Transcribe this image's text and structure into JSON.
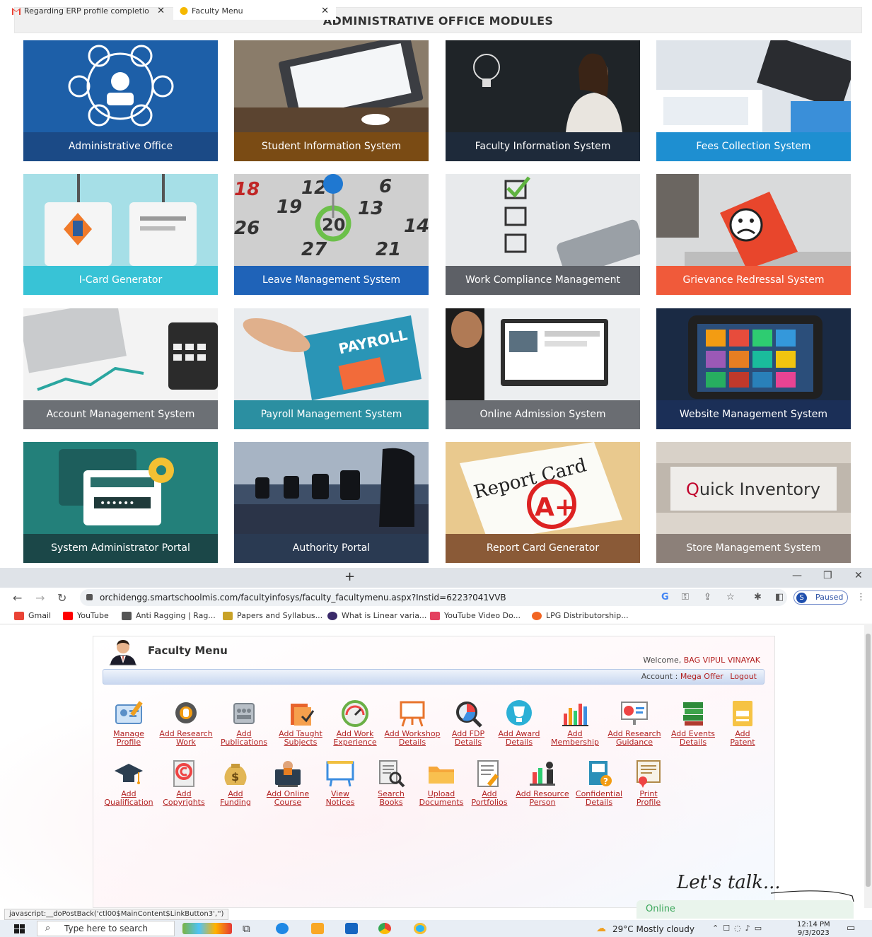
{
  "modules": {
    "heading": "ADMINISTRATIVE OFFICE MODULES",
    "tiles": [
      {
        "label": "Administrative Office",
        "color": "#1b4a86"
      },
      {
        "label": "Student Information System",
        "color": "#7a4b14"
      },
      {
        "label": "Faculty Information System",
        "color": "#1e2a3a"
      },
      {
        "label": "Fees Collection System",
        "color": "#1e8fd1"
      },
      {
        "label": "I-Card Generator",
        "color": "#38c3d6"
      },
      {
        "label": "Leave Management System",
        "color": "#1f63b8"
      },
      {
        "label": "Work Compliance Management",
        "color": "#5d6066"
      },
      {
        "label": "Grievance Redressal System",
        "color": "#f05a3a"
      },
      {
        "label": "Account Management System",
        "color": "#6c7075"
      },
      {
        "label": "Payroll Management System",
        "color": "#2b8fa1"
      },
      {
        "label": "Online Admission System",
        "color": "#6a6d72"
      },
      {
        "label": "Website Management System",
        "color": "#1b2f57"
      },
      {
        "label": "System Administrator Portal",
        "color": "#1b4748"
      },
      {
        "label": "Authority Portal",
        "color": "#2a3a52"
      },
      {
        "label": "Report Card Generator",
        "color": "#8a5a37"
      },
      {
        "label": "Store Management System",
        "color": "#8c8079"
      }
    ]
  },
  "browser": {
    "tabs": [
      {
        "title": "Regarding ERP profile completio",
        "icon": "gmail-icon"
      },
      {
        "title": "Faculty Menu",
        "icon": "site-icon"
      }
    ],
    "new_tab": "+",
    "url": "orchidengg.smartschoolmis.com/facultyinfosys/faculty_facultymenu.aspx?Instid=6223?041VVB",
    "profile_status": "Paused",
    "profile_initial": "S",
    "bookmarks": [
      {
        "label": "Gmail",
        "color": "#ea4335"
      },
      {
        "label": "YouTube",
        "color": "#ff0000"
      },
      {
        "label": "Anti Ragging | Rag...",
        "color": "#555555"
      },
      {
        "label": "Papers and Syllabus...",
        "color": "#c9a227"
      },
      {
        "label": "What is Linear varia...",
        "color": "#3a2a6a"
      },
      {
        "label": "YouTube Video Do...",
        "color": "#e4405f"
      },
      {
        "label": "LPG Distributorship...",
        "color": "#f26522"
      }
    ]
  },
  "faculty": {
    "title": "Faculty Menu",
    "welcome_prefix": "Welcome,",
    "user": "BAG VIPUL VINAYAK",
    "account_prefix": "Account :",
    "account": "Mega Offer",
    "logout": "Logout",
    "menu_items": [
      {
        "l1": "Manage",
        "l2": "Profile",
        "icon": "profile-card-icon"
      },
      {
        "l1": "Add Research",
        "l2": "Work",
        "icon": "research-gear-icon"
      },
      {
        "l1": "Add",
        "l2": "Publications",
        "icon": "publications-icon"
      },
      {
        "l1": "Add Taught",
        "l2": "Subjects",
        "icon": "subjects-icon"
      },
      {
        "l1": "Add Work",
        "l2": "Experience",
        "icon": "gauge-icon"
      },
      {
        "l1": "Add Workshop",
        "l2": "Details",
        "icon": "workshop-board-icon"
      },
      {
        "l1": "Add FDP",
        "l2": "Details",
        "icon": "magnifier-chart-icon"
      },
      {
        "l1": "Add Award",
        "l2": "Details",
        "icon": "trophy-icon"
      },
      {
        "l1": "Add",
        "l2": "Membership",
        "icon": "bar-chart-icon"
      },
      {
        "l1": "Add Research",
        "l2": "Guidance",
        "icon": "presentation-icon"
      },
      {
        "l1": "Add Events",
        "l2": "Details",
        "icon": "books-icon"
      },
      {
        "l1": "Add",
        "l2": "Patent",
        "icon": "document-icon"
      },
      {
        "l1": "Add",
        "l2": "Qualification",
        "icon": "graduation-cap-icon"
      },
      {
        "l1": "Add",
        "l2": "Copyrights",
        "icon": "copyright-icon"
      },
      {
        "l1": "Add",
        "l2": "Funding",
        "icon": "money-bag-icon"
      },
      {
        "l1": "Add Online",
        "l2": "Course",
        "icon": "online-course-icon"
      },
      {
        "l1": "View",
        "l2": "Notices",
        "icon": "notice-board-icon"
      },
      {
        "l1": "Search",
        "l2": "Books",
        "icon": "search-book-icon"
      },
      {
        "l1": "Upload",
        "l2": "Documents",
        "icon": "folder-icon"
      },
      {
        "l1": "Add",
        "l2": "Portfolios",
        "icon": "portfolio-icon"
      },
      {
        "l1": "Add Resource",
        "l2": "Person",
        "icon": "resource-person-icon"
      },
      {
        "l1": "Confidential",
        "l2": "Details",
        "icon": "confidential-book-icon"
      },
      {
        "l1": "Print",
        "l2": "Profile",
        "icon": "certificate-icon"
      }
    ],
    "chat_title": "Let's talk...",
    "online_status": "Online"
  },
  "status_url": "javascript:__doPostBack('ctl00$MainContent$LinkButton3','')",
  "taskbar": {
    "search_placeholder": "Type here to search",
    "weather": "29°C  Mostly cloudy",
    "time": "12:14 PM",
    "date": "9/3/2023"
  }
}
